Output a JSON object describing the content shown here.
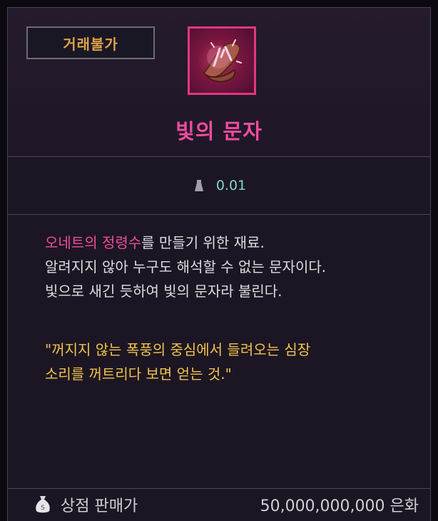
{
  "trade_badge": "거래불가",
  "item": {
    "name": "빛의 문자",
    "icon": "rune-scroll-icon",
    "weight": "0.01"
  },
  "description": {
    "highlight": "오네트의 정령수",
    "line1_rest": "를 만들기 위한 재료.",
    "line2": "알려지지 않아 누구도 해석할 수 없는 문자이다.",
    "line3": "빛으로 새긴 듯하여 빛의 문자라 불린다."
  },
  "quote": {
    "line1": "\"꺼지지 않는 폭풍의 중심에서 들려오는 심장",
    "line2": "소리를 꺼트리다 보면 얻는 것.\""
  },
  "price": {
    "label": "상점 판매가",
    "value": "50,000,000,000 은화"
  },
  "colors": {
    "item_name": "#f04c9c",
    "badge_text": "#d9a24a",
    "weight": "#7fd6c8",
    "quote": "#f0c24a",
    "icon_border": "#e0387f"
  }
}
